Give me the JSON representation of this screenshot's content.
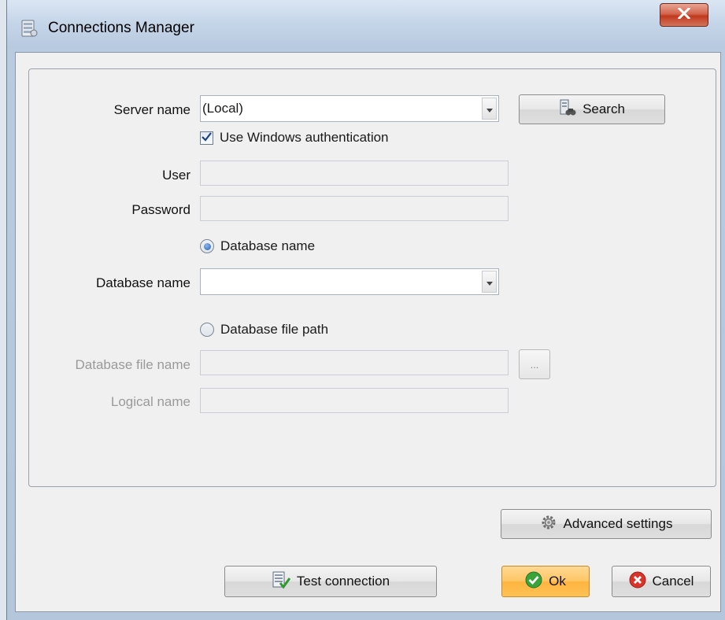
{
  "window": {
    "title": "Connections Manager",
    "close_glyph": "X"
  },
  "form": {
    "server_name_label": "Server name",
    "server_name_value": "(Local)",
    "search_button": "Search",
    "use_windows_auth_label": "Use Windows authentication",
    "use_windows_auth_checked": true,
    "user_label": "User",
    "password_label": "Password",
    "database_name_radio": "Database name",
    "database_name_label": "Database name",
    "database_name_value": "",
    "database_file_path_radio": "Database file path",
    "database_file_name_label": "Database file name",
    "browse_button": "...",
    "logical_name_label": "Logical name"
  },
  "buttons": {
    "advanced_settings": "Advanced settings",
    "test_connection": "Test connection",
    "ok": "Ok",
    "cancel": "Cancel"
  },
  "icons": {
    "title": "database-icon",
    "search": "server-binoculars-icon",
    "advanced": "gear-icon",
    "test": "checklist-icon",
    "ok": "check-circle-icon",
    "cancel": "cancel-circle-icon"
  },
  "colors": {
    "ok_button": "#ffc766",
    "cancel_red": "#d9342b",
    "ok_green": "#3aa33a",
    "close_red": "#c0391d",
    "radio_selected": "#1e5fb8"
  }
}
